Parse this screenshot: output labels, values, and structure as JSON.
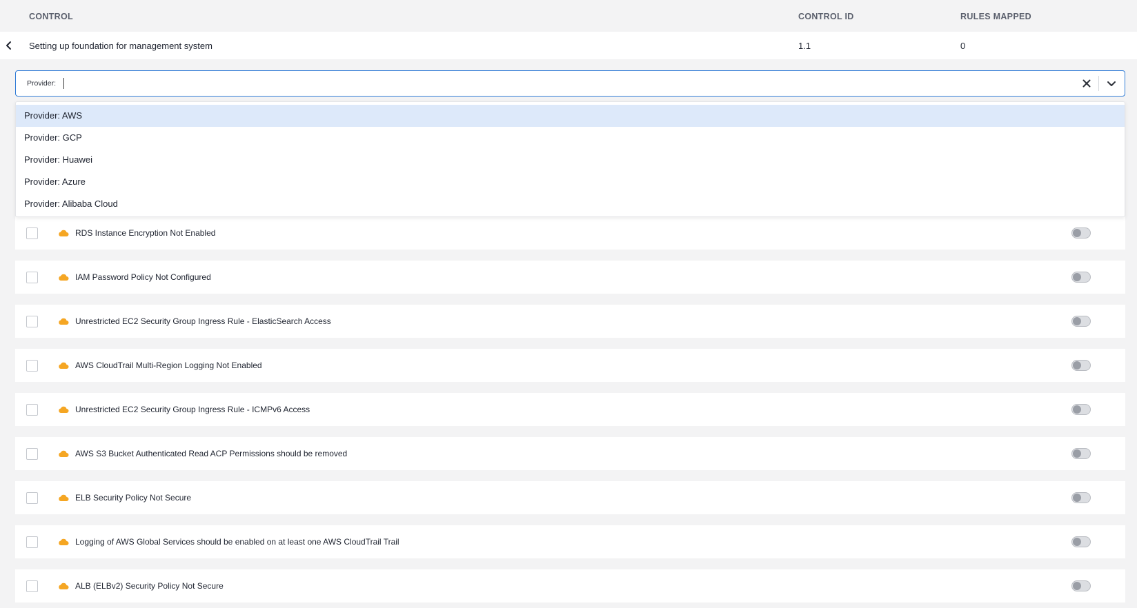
{
  "header": {
    "control_col": "CONTROL",
    "control_id_col": "CONTROL ID",
    "rules_mapped_col": "RULES MAPPED"
  },
  "control": {
    "name": "Setting up foundation for management system",
    "id": "1.1",
    "rules_mapped": "0"
  },
  "provider_select": {
    "label": "Provider:",
    "value": "",
    "options": [
      "Provider: AWS",
      "Provider: GCP",
      "Provider: Huawei",
      "Provider: Azure",
      "Provider: Alibaba Cloud"
    ],
    "highlighted_index": 0
  },
  "rules": [
    {
      "title": "RDS Instance Encryption Not Enabled",
      "provider_icon": "aws-cloud-icon",
      "checked": false,
      "enabled": false
    },
    {
      "title": "IAM Password Policy Not Configured",
      "provider_icon": "aws-cloud-icon",
      "checked": false,
      "enabled": false
    },
    {
      "title": "Unrestricted EC2 Security Group Ingress Rule - ElasticSearch Access",
      "provider_icon": "aws-cloud-icon",
      "checked": false,
      "enabled": false
    },
    {
      "title": "AWS CloudTrail Multi-Region Logging Not Enabled",
      "provider_icon": "aws-cloud-icon",
      "checked": false,
      "enabled": false
    },
    {
      "title": "Unrestricted EC2 Security Group Ingress Rule - ICMPv6 Access",
      "provider_icon": "aws-cloud-icon",
      "checked": false,
      "enabled": false
    },
    {
      "title": "AWS S3 Bucket Authenticated Read ACP Permissions should be removed",
      "provider_icon": "aws-cloud-icon",
      "checked": false,
      "enabled": false
    },
    {
      "title": "ELB Security Policy Not Secure",
      "provider_icon": "aws-cloud-icon",
      "checked": false,
      "enabled": false
    },
    {
      "title": "Logging of AWS Global Services should be enabled on at least one AWS CloudTrail Trail",
      "provider_icon": "aws-cloud-icon",
      "checked": false,
      "enabled": false
    },
    {
      "title": "ALB (ELBv2) Security Policy Not Secure",
      "provider_icon": "aws-cloud-icon",
      "checked": false,
      "enabled": false
    }
  ],
  "colors": {
    "accent": "#2f7bd6",
    "highlight": "#dde9fa",
    "aws_icon": "#f5a623"
  }
}
